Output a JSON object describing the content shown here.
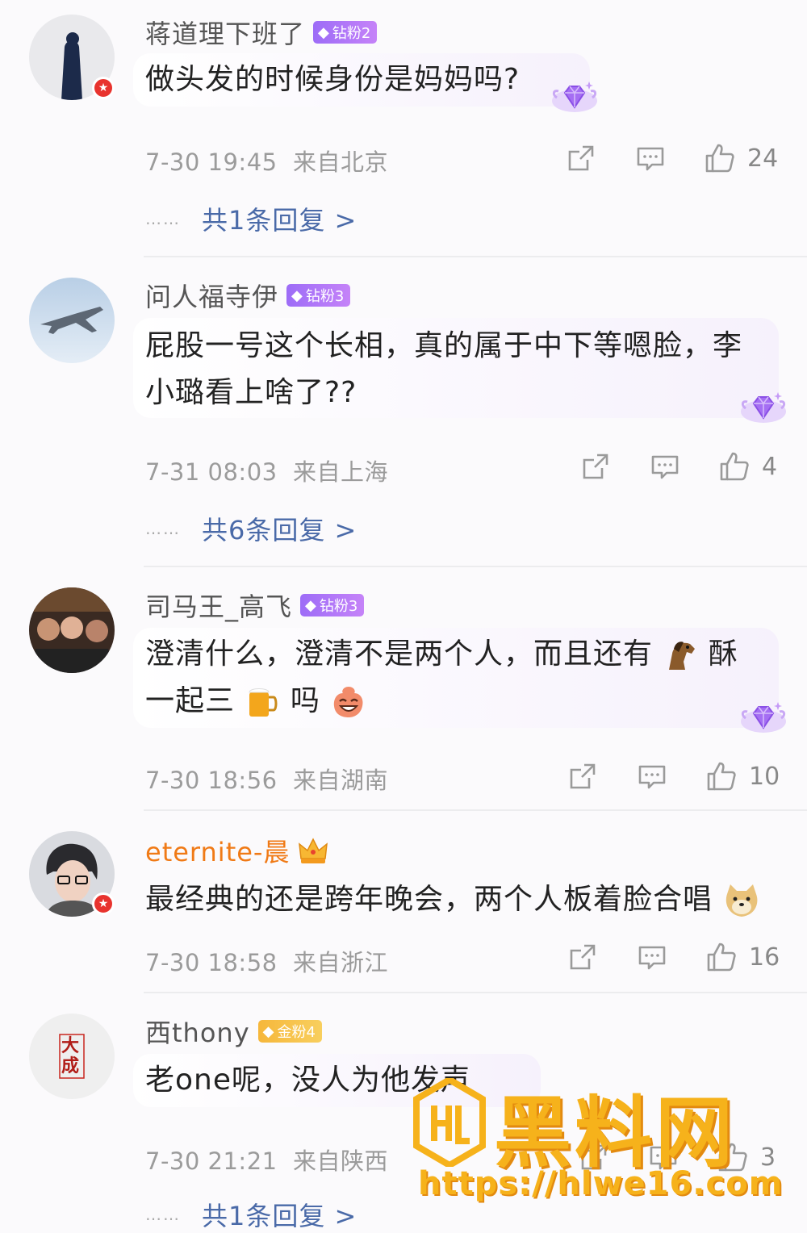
{
  "comments": [
    {
      "username": "蒋道理下班了",
      "badge": "钻粉2",
      "text": [
        "做头发的时候身份是妈妈吗?"
      ],
      "time": "7-30 19:45",
      "location": "来自北京",
      "likes": "24",
      "replies": "共1条回复 >"
    },
    {
      "username": "问人福寺伊",
      "badge": "钻粉3",
      "text": [
        "屁股一号这个长相，真的属于中下等嗯脸，李",
        "小璐看上啥了??"
      ],
      "time": "7-31 08:03",
      "location": "来自上海",
      "likes": "4",
      "replies": "共6条回复 >"
    },
    {
      "username": "司马王_高飞",
      "badge": "钻粉3",
      "text_line1_a": "澄清什么，澄清不是两个人，而且还有",
      "text_line1_b": "酥",
      "text_line2_a": "一起三",
      "text_line2_b": "吗",
      "time": "7-30 18:56",
      "location": "来自湖南",
      "likes": "10"
    },
    {
      "username": "eternite-晨",
      "text": [
        "最经典的还是跨年晚会，两个人板着脸合唱"
      ],
      "time": "7-30 18:58",
      "location": "来自浙江",
      "likes": "16"
    },
    {
      "username": "西thony",
      "badge": "金粉4",
      "text": [
        "老one呢，没人为他发声"
      ],
      "time": "7-30 21:21",
      "location": "来自陕西",
      "likes": "3",
      "replies": "共1条回复 >",
      "avatar_text": "大成"
    }
  ],
  "reply_dots": "……",
  "watermark": {
    "title": "黑料网",
    "url": "https://hlwe16.com"
  },
  "colors": {
    "link": "#4a6aa8",
    "meta": "#9b9b9b",
    "diamond_badge": "#a772f7",
    "gold_badge": "#f6b73b",
    "watermark": "#f6b21b"
  }
}
